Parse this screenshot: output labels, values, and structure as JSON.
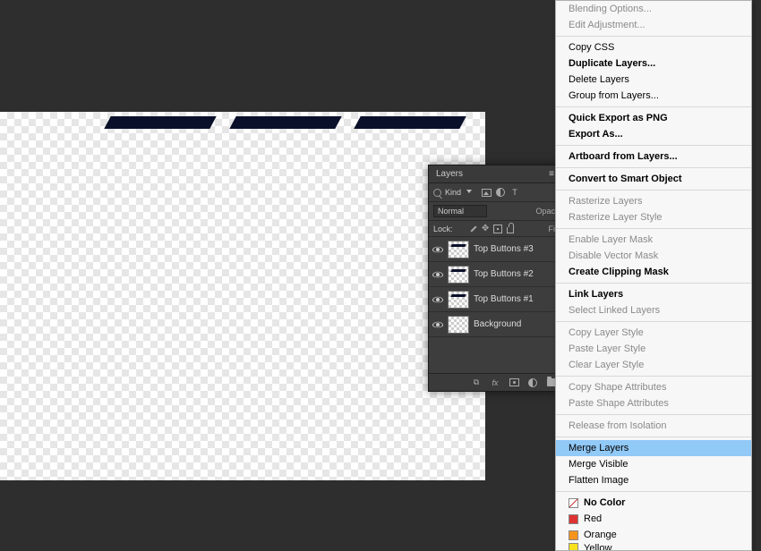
{
  "layers_panel": {
    "tab_label": "Layers",
    "filter": {
      "kind_label": "Kind",
      "type_icon_T": "T"
    },
    "blend_mode": "Normal",
    "opacity_label": "Opaci",
    "lock_label": "Lock:",
    "fill_label": "Fil",
    "layers": [
      {
        "name": "Top Buttons #3"
      },
      {
        "name": "Top Buttons #2"
      },
      {
        "name": "Top Buttons #1"
      },
      {
        "name": "Background"
      }
    ],
    "footer_fx": "fx"
  },
  "context_menu": {
    "items": [
      {
        "label": "Blending Options...",
        "disabled": true
      },
      {
        "label": "Edit Adjustment...",
        "disabled": true
      },
      {
        "sep": true
      },
      {
        "label": "Copy CSS"
      },
      {
        "label": "Duplicate Layers...",
        "bold": true
      },
      {
        "label": "Delete Layers"
      },
      {
        "label": "Group from Layers..."
      },
      {
        "sep": true
      },
      {
        "label": "Quick Export as PNG",
        "bold": true
      },
      {
        "label": "Export As...",
        "bold": true
      },
      {
        "sep": true
      },
      {
        "label": "Artboard from Layers...",
        "bold": true
      },
      {
        "sep": true
      },
      {
        "label": "Convert to Smart Object",
        "bold": true
      },
      {
        "sep": true
      },
      {
        "label": "Rasterize Layers",
        "disabled": true
      },
      {
        "label": "Rasterize Layer Style",
        "disabled": true
      },
      {
        "sep": true
      },
      {
        "label": "Enable Layer Mask",
        "disabled": true
      },
      {
        "label": "Disable Vector Mask",
        "disabled": true
      },
      {
        "label": "Create Clipping Mask",
        "bold": true
      },
      {
        "sep": true
      },
      {
        "label": "Link Layers",
        "bold": true
      },
      {
        "label": "Select Linked Layers",
        "disabled": true
      },
      {
        "sep": true
      },
      {
        "label": "Copy Layer Style",
        "disabled": true
      },
      {
        "label": "Paste Layer Style",
        "disabled": true
      },
      {
        "label": "Clear Layer Style",
        "disabled": true
      },
      {
        "sep": true
      },
      {
        "label": "Copy Shape Attributes",
        "disabled": true
      },
      {
        "label": "Paste Shape Attributes",
        "disabled": true
      },
      {
        "sep": true
      },
      {
        "label": "Release from Isolation",
        "disabled": true
      },
      {
        "sep": true
      },
      {
        "label": "Merge Layers",
        "hover": true
      },
      {
        "label": "Merge Visible"
      },
      {
        "label": "Flatten Image"
      },
      {
        "sep": true
      },
      {
        "label": "No Color",
        "bold": true,
        "color": "none"
      },
      {
        "label": "Red",
        "color": "red"
      },
      {
        "label": "Orange",
        "color": "orange"
      },
      {
        "label": "Yellow",
        "color": "yellow",
        "cut": true
      }
    ]
  }
}
